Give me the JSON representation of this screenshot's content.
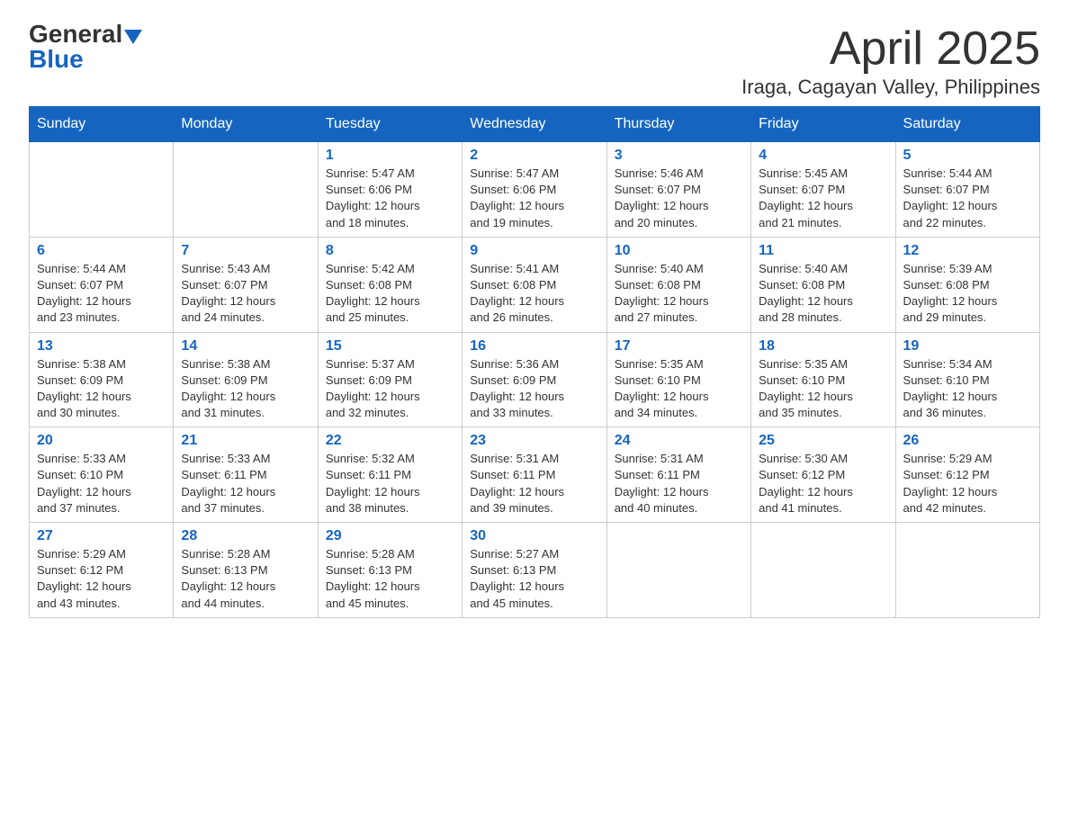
{
  "logo": {
    "general": "General",
    "blue": "Blue"
  },
  "header": {
    "month": "April 2025",
    "location": "Iraga, Cagayan Valley, Philippines"
  },
  "weekdays": [
    "Sunday",
    "Monday",
    "Tuesday",
    "Wednesday",
    "Thursday",
    "Friday",
    "Saturday"
  ],
  "weeks": [
    [
      {
        "day": null,
        "info": null
      },
      {
        "day": null,
        "info": null
      },
      {
        "day": "1",
        "info": "Sunrise: 5:47 AM\nSunset: 6:06 PM\nDaylight: 12 hours\nand 18 minutes."
      },
      {
        "day": "2",
        "info": "Sunrise: 5:47 AM\nSunset: 6:06 PM\nDaylight: 12 hours\nand 19 minutes."
      },
      {
        "day": "3",
        "info": "Sunrise: 5:46 AM\nSunset: 6:07 PM\nDaylight: 12 hours\nand 20 minutes."
      },
      {
        "day": "4",
        "info": "Sunrise: 5:45 AM\nSunset: 6:07 PM\nDaylight: 12 hours\nand 21 minutes."
      },
      {
        "day": "5",
        "info": "Sunrise: 5:44 AM\nSunset: 6:07 PM\nDaylight: 12 hours\nand 22 minutes."
      }
    ],
    [
      {
        "day": "6",
        "info": "Sunrise: 5:44 AM\nSunset: 6:07 PM\nDaylight: 12 hours\nand 23 minutes."
      },
      {
        "day": "7",
        "info": "Sunrise: 5:43 AM\nSunset: 6:07 PM\nDaylight: 12 hours\nand 24 minutes."
      },
      {
        "day": "8",
        "info": "Sunrise: 5:42 AM\nSunset: 6:08 PM\nDaylight: 12 hours\nand 25 minutes."
      },
      {
        "day": "9",
        "info": "Sunrise: 5:41 AM\nSunset: 6:08 PM\nDaylight: 12 hours\nand 26 minutes."
      },
      {
        "day": "10",
        "info": "Sunrise: 5:40 AM\nSunset: 6:08 PM\nDaylight: 12 hours\nand 27 minutes."
      },
      {
        "day": "11",
        "info": "Sunrise: 5:40 AM\nSunset: 6:08 PM\nDaylight: 12 hours\nand 28 minutes."
      },
      {
        "day": "12",
        "info": "Sunrise: 5:39 AM\nSunset: 6:08 PM\nDaylight: 12 hours\nand 29 minutes."
      }
    ],
    [
      {
        "day": "13",
        "info": "Sunrise: 5:38 AM\nSunset: 6:09 PM\nDaylight: 12 hours\nand 30 minutes."
      },
      {
        "day": "14",
        "info": "Sunrise: 5:38 AM\nSunset: 6:09 PM\nDaylight: 12 hours\nand 31 minutes."
      },
      {
        "day": "15",
        "info": "Sunrise: 5:37 AM\nSunset: 6:09 PM\nDaylight: 12 hours\nand 32 minutes."
      },
      {
        "day": "16",
        "info": "Sunrise: 5:36 AM\nSunset: 6:09 PM\nDaylight: 12 hours\nand 33 minutes."
      },
      {
        "day": "17",
        "info": "Sunrise: 5:35 AM\nSunset: 6:10 PM\nDaylight: 12 hours\nand 34 minutes."
      },
      {
        "day": "18",
        "info": "Sunrise: 5:35 AM\nSunset: 6:10 PM\nDaylight: 12 hours\nand 35 minutes."
      },
      {
        "day": "19",
        "info": "Sunrise: 5:34 AM\nSunset: 6:10 PM\nDaylight: 12 hours\nand 36 minutes."
      }
    ],
    [
      {
        "day": "20",
        "info": "Sunrise: 5:33 AM\nSunset: 6:10 PM\nDaylight: 12 hours\nand 37 minutes."
      },
      {
        "day": "21",
        "info": "Sunrise: 5:33 AM\nSunset: 6:11 PM\nDaylight: 12 hours\nand 37 minutes."
      },
      {
        "day": "22",
        "info": "Sunrise: 5:32 AM\nSunset: 6:11 PM\nDaylight: 12 hours\nand 38 minutes."
      },
      {
        "day": "23",
        "info": "Sunrise: 5:31 AM\nSunset: 6:11 PM\nDaylight: 12 hours\nand 39 minutes."
      },
      {
        "day": "24",
        "info": "Sunrise: 5:31 AM\nSunset: 6:11 PM\nDaylight: 12 hours\nand 40 minutes."
      },
      {
        "day": "25",
        "info": "Sunrise: 5:30 AM\nSunset: 6:12 PM\nDaylight: 12 hours\nand 41 minutes."
      },
      {
        "day": "26",
        "info": "Sunrise: 5:29 AM\nSunset: 6:12 PM\nDaylight: 12 hours\nand 42 minutes."
      }
    ],
    [
      {
        "day": "27",
        "info": "Sunrise: 5:29 AM\nSunset: 6:12 PM\nDaylight: 12 hours\nand 43 minutes."
      },
      {
        "day": "28",
        "info": "Sunrise: 5:28 AM\nSunset: 6:13 PM\nDaylight: 12 hours\nand 44 minutes."
      },
      {
        "day": "29",
        "info": "Sunrise: 5:28 AM\nSunset: 6:13 PM\nDaylight: 12 hours\nand 45 minutes."
      },
      {
        "day": "30",
        "info": "Sunrise: 5:27 AM\nSunset: 6:13 PM\nDaylight: 12 hours\nand 45 minutes."
      },
      {
        "day": null,
        "info": null
      },
      {
        "day": null,
        "info": null
      },
      {
        "day": null,
        "info": null
      }
    ]
  ]
}
